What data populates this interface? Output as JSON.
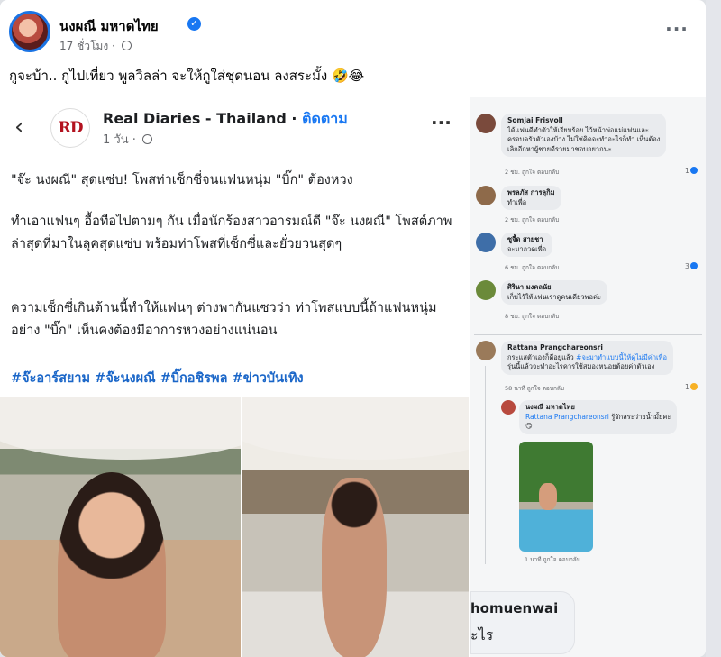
{
  "post": {
    "author": "นงผณี มหาดไทย",
    "time": "17 ชั่วโมง ·",
    "caption": "กูจะบ้า.. กูไปเที่ยว พูลวิลล่า จะให้กูใส่ชุดนอน ลงสระมั้ง 🤣😂"
  },
  "shared_post": {
    "back_icon": "back-arrow-icon",
    "logo_text": "RD",
    "page_name": "Real Diaries - Thailand ·",
    "follow_label": "ติดตาม",
    "meta": "1 วัน ·",
    "paragraphs": [
      "\"จ๊ะ นงผณี\" สุดแซ่บ! โพสท่าเซ็กซี่จนแฟนหนุ่ม \"บิ๊ก\" ต้องหวง",
      "ทำเอาแฟนๆ อื้อทือไปตามๆ กัน เมื่อนักร้องสาวอารมณ์ดี \"จ๊ะ นงผณี\" โพสต์ภาพล่าสุดที่มาในลุคสุดแซ่บ พร้อมท่าโพสที่เซ็กซี่และยั่วยวนสุดๆ",
      "ความเซ็กซี่เกินต้านนี้ทำให้แฟนๆ ต่างพากันแซวว่า ท่าโพสแบบนี้ถ้าแฟนหนุ่มอย่าง \"บิ๊ก\" เห็นคงต้องมีอาการหวงอย่างแน่นอน"
    ],
    "hashtags": "#จ๊ะอาร์สยาม #จ๊ะนงผณี #บิ๊กอชิรพล #ข่าวบันเทิง"
  },
  "comments": [
    {
      "name": "Somjai Frisvoll",
      "text_lines": [
        "ได้แฟนดีทำตัวให้เรียบร้อย ไว้หน้าพ่อแม่แฟนและ",
        "ครอบครัวตัวเองบ้าง ไม่ใช่คิดจะทำอะไรก็ทำ เห็นต้อง",
        "เลิกอีกหาผู้ชายดีรวยมาชอบอยากนะ"
      ],
      "actions": "2 ชม.   ถูกใจ   ตอบกลับ",
      "count": "1"
    },
    {
      "name": "พรลภัส การลุกิม",
      "text_lines": [
        "ทำเพื่อ"
      ],
      "actions": "2 ชม.   ถูกใจ   ตอบกลับ",
      "count": ""
    },
    {
      "name": "ซูจี้ด สายชา",
      "text_lines": [
        "จะมาอวดเพื่อ"
      ],
      "actions": "6 ชม.   ถูกใจ   ตอบกลับ",
      "count": "3"
    },
    {
      "name": "ศิรินา มงคลนัย",
      "text_lines": [
        "เก็บไว้ให้แฟนเราดูคนเดียวพอค่ะ"
      ],
      "actions": "8 ชม.   ถูกใจ   ตอบกลับ",
      "count": ""
    },
    {
      "name": "Rattana Prangchareonsri",
      "text_pre": "กระแสตัวเองก็ดีอยู่แล้ว ",
      "text_mention": "#จะมาทำแบบนี้ให้ดูไม่มีค่าเพื่อ",
      "text_line2": "รุ่นนี้แล้วจะทำอะไรควรใช้สมองหน่อยต้อยค่าตัวเอง",
      "actions": "58 นาที   ถูกใจ   ตอบกลับ",
      "count": "1"
    }
  ],
  "reply": {
    "name": "นงผณี มหาดไทย",
    "mention": "Rattana Prangchareonsri",
    "text": " รู้จักสระว่ายน้ำมั้ยคะ",
    "emoji": "😏",
    "actions": "1 นาที   ถูกใจ   ตอบกลับ"
  },
  "bottom_comment": {
    "name": "homuenwai",
    "text": "ะไร"
  }
}
